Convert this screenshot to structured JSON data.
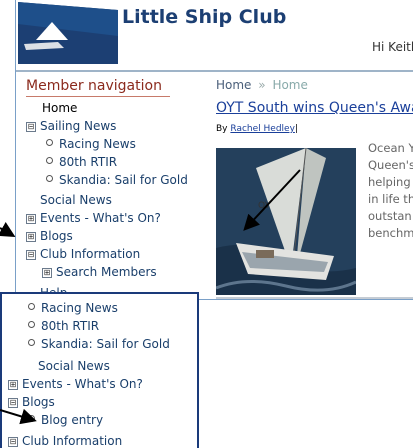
{
  "header": {
    "site_name": "Little Ship Club",
    "greeting": "Hi Keith"
  },
  "nav": {
    "title": "Member navigation",
    "items": [
      {
        "label": "Home"
      },
      {
        "label": "Sailing News",
        "toggle": "⊟"
      },
      {
        "label": "Racing News"
      },
      {
        "label": "80th RTIR"
      },
      {
        "label": "Skandia: Sail for Gold"
      },
      {
        "label": "Social News"
      },
      {
        "label": "Events - What's On?",
        "toggle": "⊞"
      },
      {
        "label": "Blogs",
        "toggle": "⊞"
      },
      {
        "label": "Club Information",
        "toggle": "⊟"
      },
      {
        "label": "Search Members",
        "toggle": "⊞"
      },
      {
        "label": "Help"
      }
    ]
  },
  "breadcrumb": {
    "home": "Home",
    "separator": "»",
    "current": "Home"
  },
  "article": {
    "title": "OYT South wins Queen's Awa",
    "by": "By",
    "author": "Rachel Hedley",
    "author_sep": "|",
    "excerpt_lines": [
      "Ocean Y",
      "Queen's",
      "helping",
      "in life th",
      "outstan",
      "benchm"
    ]
  },
  "nav_after": {
    "items": [
      {
        "label": "Racing News"
      },
      {
        "label": "80th RTIR"
      },
      {
        "label": "Skandia: Sail for Gold"
      },
      {
        "label": "Social News"
      },
      {
        "label": "Events - What's On?",
        "toggle": "⊞"
      },
      {
        "label": "Blogs",
        "toggle": "⊟"
      },
      {
        "label": "Blog entry"
      },
      {
        "label": "Club Information",
        "toggle": "⊟"
      }
    ]
  },
  "colors": {
    "brand_navy": "#1c3f73",
    "nav_title_red": "#8b2a1d",
    "link_blue": "#1a3f9a",
    "highlight_border": "#1a3a7a"
  }
}
